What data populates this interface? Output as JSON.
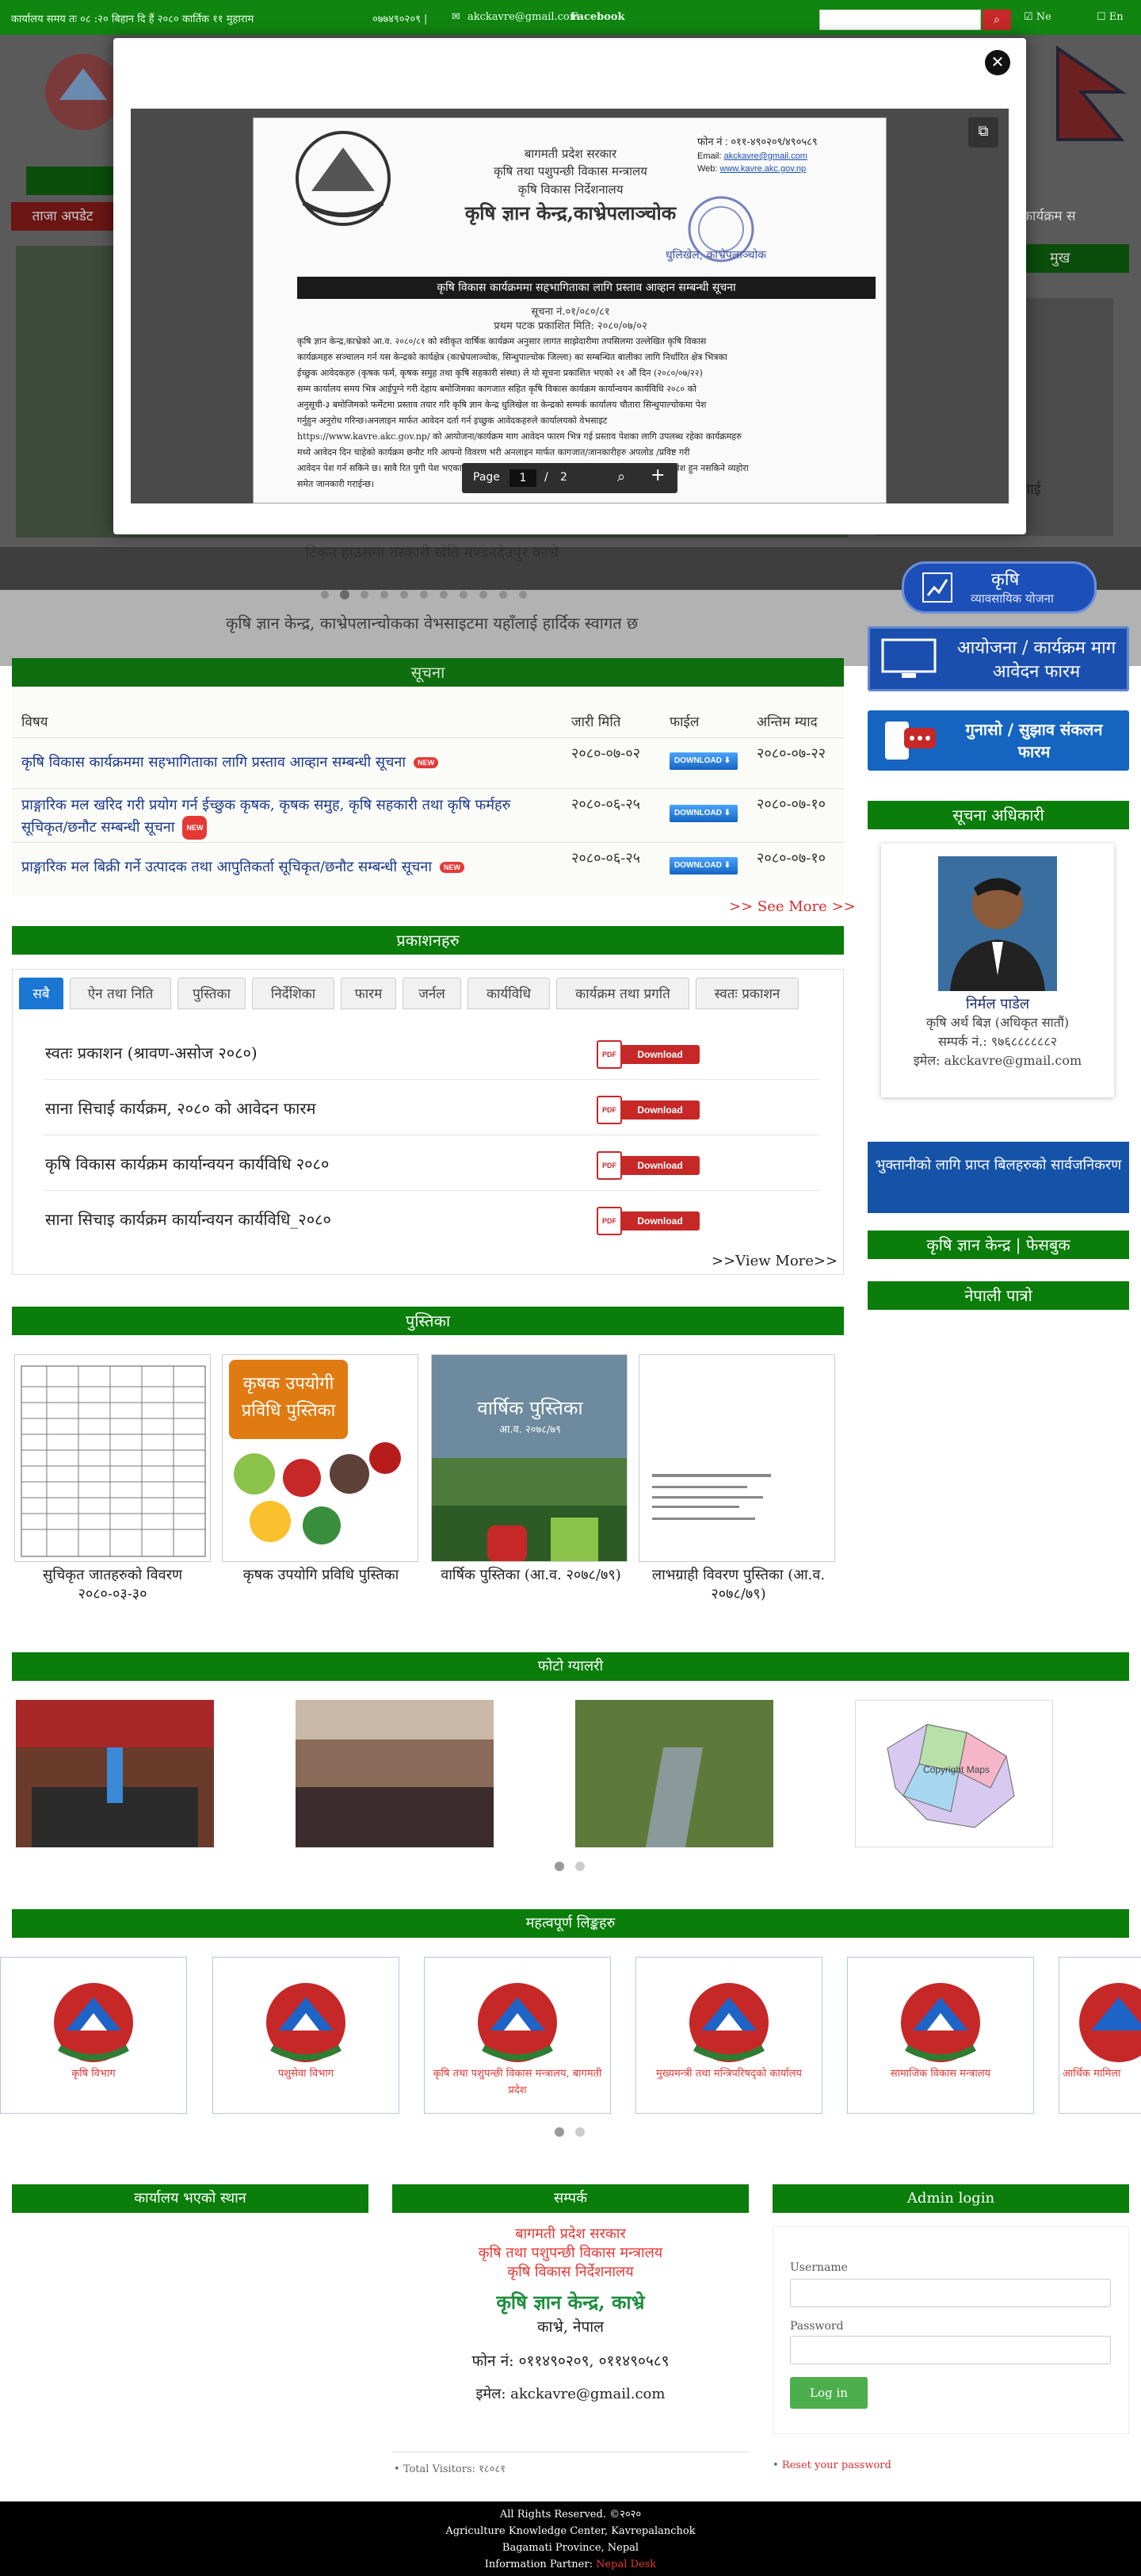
{
  "topbar": {
    "marquee": "कार्यालय समय तः ०८ :२० बिहान  दि हैं २०८० कार्तिक ११ मुहाराम",
    "phone": "०७७४९०२०९ |",
    "email": "akckavre@gmail.com",
    "facebook": "Facebook",
    "lang_ne": "Ne",
    "lang_en": "En"
  },
  "modal": {
    "close": "✕",
    "page_label": "Page",
    "page_current": "1",
    "page_sep": "/",
    "page_total": "2",
    "doc": {
      "phone": "फोन नं : ०११-४९०२०९/४९०५८९",
      "email_label": "Email:",
      "email": "akckavre@gmail.com",
      "web_label": "Web:",
      "web": "www.kavre.akc.gov.np",
      "gov": "बागमती प्रदेश सरकार",
      "ministry": "कृषि तथा पशुपन्छी विकास मन्त्रालय",
      "directorate": "कृषि विकास निर्देशनालय",
      "office": "कृषि ज्ञान केन्द्र,काभ्रेपलाञ्चोक",
      "location": "धुलिखेल, काभ्रेपलाञ्चोक",
      "heading": "कृषि विकास कार्यक्रममा सहभागिताका लागि प्रस्ताव आव्हान सम्बन्धी सूचना",
      "notice_no": "सूचना नं.०१/०८०/८१",
      "pub_date": "प्रथम पटक प्रकाशित मिति: २०८०/०७/०२",
      "body": [
        "कृषि ज्ञान केन्द्र,काभ्रेको आ.व. २०८०/८१ को स्वीकृत वार्षिक कार्यक्रम अनुसार लागत साझेदारीमा तपसिलमा उल्लेखित कृषि विकास",
        "कार्यक्रमहरु सञ्चालन गर्न यस केन्द्रको कार्यक्षेत्र (काभ्रेपलाञ्चोक, सिन्धुपाल्चोक जिल्ला) का सम्बन्धित बालीका लागि निर्धारित क्षेत्र भित्रका",
        "ईच्छुक आवेदकहरु (कृषक फर्म, कृषक समुह तथा कृषि सहकारी संस्था) ले यो सूचना प्रकाशित भएको २१ औं दिन (२०८०/०७/२२)",
        "सम्म कार्यालय समय भित्र आईपुग्ने गरी देहाय बमोजिमका कागजात सहित कृषि विकास कार्यक्रम कार्यान्वयन कार्यविधि २०८० को",
        "अनुसूची-३ बमोजिमको फर्मेटमा प्रस्ताव तयार गरि कृषि ज्ञान केन्द्र धुलिखेल वा केन्द्रको सम्पर्क कार्यालय चौतारा सिन्धुपाल्चोकमा पेश",
        "गर्नुहुन अनुरोध गरिन्छ।अनलाइन मार्फत आवेदन दर्ता गर्न इच्छुक आवेदकहरुले कार्यालयको वेभसाइट",
        "https://www.kavre.akc.gov.np/ को आयोजना/कार्यक्रम माग आवेदन फारम भित्र गई प्रस्ताव पेशका लागि उपलब्ध रहेका कार्यक्रमहरु",
        "मध्ये आवेदन दिन चाहेको कार्यक्रम छनौट गरि आफ्नो विवरण भरी अनलाइन मार्फत कागजात/जानकारीहरु अपलोड /प्रविष्ट गरी",
        "आवेदन पेश गर्न सकिने छ। सावै रित पुगी पेश भएका प्रस्तावहरु मध्येबाट छनौट भएका प्रस्तावहरुलाई छनौटका लागि समावेश हुन नसकिने व्यहोरा",
        "समेत जानकारी गराईन्छ।"
      ]
    }
  },
  "header_hidden": {
    "news_label": "ताजा अपडेट",
    "right_label": "कार्यक्रम स",
    "main_label": "मुख"
  },
  "slider": {
    "caption_main": "टिकन हाउसमा तरकारी खेति मण्डनदेउपुर काभ्रे",
    "caption_sub": "कृषि ज्ञान केन्द्र, काभ्रेपलान्चोकका वेभसाइटमा यहाँलाई हार्दिक स्वागत छ",
    "right_caption": "गाई"
  },
  "notices": {
    "title": "सूचना",
    "headers": [
      "विषय",
      "जारी मिति",
      "फाईल",
      "अन्तिम म्याद"
    ],
    "download_label": "DOWNLOAD",
    "new_label": "NEW",
    "rows": [
      {
        "subject": "कृषि विकास कार्यक्रममा सहभागिताका लागि प्रस्ताव आव्हान सम्बन्धी सूचना",
        "issued": "२०८०-०७-०२",
        "deadline": "२०८०-०७-२२"
      },
      {
        "subject": "प्राङ्गारिक मल खरिद गरी प्रयोग गर्न ईच्छुक कृषक, कृषक समुह, कृषि सहकारी तथा कृषि फर्महरु सूचिकृत/छनौट सम्बन्धी सूचना",
        "issued": "२०८०-०६-२५",
        "deadline": "२०८०-०७-१०"
      },
      {
        "subject": "प्राङ्गारिक मल बिक्री गर्ने उत्पादक तथा आपुतिकर्ता सूचिकृत/छनौट सम्बन्धी सूचना",
        "issued": "२०८०-०६-२५",
        "deadline": "२०८०-०७-१०"
      }
    ],
    "see_more": ">> See More >>"
  },
  "publications": {
    "title": "प्रकाशनहरु",
    "tabs": [
      "सबै",
      "ऐन तथा निति",
      "पुस्तिका",
      "निर्देशिका",
      "फारम",
      "जर्नल",
      "कार्यविधि",
      "कार्यक्रम तथा प्रगति",
      "स्वतः प्रकाशन"
    ],
    "pdf_label": "PDF",
    "download_label": "Download",
    "items": [
      "स्वतः प्रकाशन (श्रावण-असोज २०८०)",
      "साना सिचाई कार्यक्रम, २०८० को आवेदन फारम",
      "कृषि विकास कार्यक्रम कार्यान्वयन कार्यविधि २०८०",
      "साना सिचाइ कार्यक्रम कार्यान्वयन कार्यविधि_२०८०"
    ],
    "view_more": ">>View More>>"
  },
  "booklets": {
    "title": "पुस्तिका",
    "items": [
      "सुचिकृत जातहरुको विवरण २०८०-०३-३०",
      "कृषक उपयोगि प्रविधि पुस्तिका",
      "वार्षिक पुस्तिका (आ.व. २०७८/७९)",
      "लाभग्राही विवरण पुस्तिका (आ.व. २०७८/७९)"
    ],
    "cover2_title": "कृषक उपयोगी प्रविधि पुस्तिका",
    "cover3_title": "वार्षिक पुस्तिका",
    "cover3_sub": "आ.व. २०७८/७९"
  },
  "gallery": {
    "title": "फोटो ग्यालरी",
    "map_caption": "Copyright Maps"
  },
  "links": {
    "title": "महत्वपूर्ण लिङ्कहरु",
    "items": [
      "कृषि विभाग",
      "पशुसेवा विभाग",
      "कृषि तथा पशुपन्छी विकास मन्त्रालय, बागमती प्रदेश",
      "मुख्यमन्त्री तथा मन्त्रिपरिषद्को कार्यालय",
      "सामाजिक विकास मन्त्रालय",
      "आर्थिक मामिला"
    ]
  },
  "sidebar": {
    "banner1_title": "कृषि",
    "banner1_sub": "व्यावसायिक योजना",
    "banner2": "आयोजना / कार्यक्रम माग आवेदन फारम",
    "banner3": "गुनासो / सुझाव संकलन फारम",
    "info_officer_title": "सूचना अधिकारी",
    "officer": {
      "name": "निर्मल पाडेल",
      "role": "कृषि अर्थ बिज्ञ (अधिकृत सातौं)",
      "phone": "सम्पर्क नं.: ९७६८८८८८८२",
      "email": "इमेल: akckavre@gmail.com"
    },
    "payment_button": "भुक्तानीको लागि प्राप्त बिलहरुको सार्वजनिकरण",
    "facebook_header": "कृषि ज्ञान केन्द्र | फेसबुक",
    "calendar_header": "नेपाली पात्रो"
  },
  "footer": {
    "location_title": "कार्यालय भएको स्थान",
    "contact_title": "सम्पर्क",
    "admin_title": "Admin login",
    "gov": "बागमती प्रदेश सरकार",
    "ministry": "कृषि तथा पशुपन्छी विकास मन्त्रालय",
    "directorate": "कृषि विकास निर्देशनालय",
    "office": "कृषि ज्ञान केन्द्र, काभ्रे",
    "district": "काभ्रे, नेपाल",
    "phone": "फोन नं: ०११४९०२०९, ०११४९०५८९",
    "email": "इमेल: akckavre@gmail.com",
    "visitors": "Total Visitors: १८०८१",
    "username_label": "Username",
    "password_label": "Password",
    "login_button": "Log in",
    "reset_link": "Reset your password"
  },
  "bottom": {
    "line1": "All Rights Reserved. ©२०२०",
    "line2": "Agriculture Knowledge Center, Kavrepalanchok",
    "line3": "Bagamati Province, Nepal",
    "line4_label": "Information Partner:",
    "line4_partner": "Nepal Desk"
  },
  "colors": {
    "brand_green": "#0a7d0a",
    "accent_red": "#d32f2f",
    "accent_blue": "#1976d2"
  }
}
